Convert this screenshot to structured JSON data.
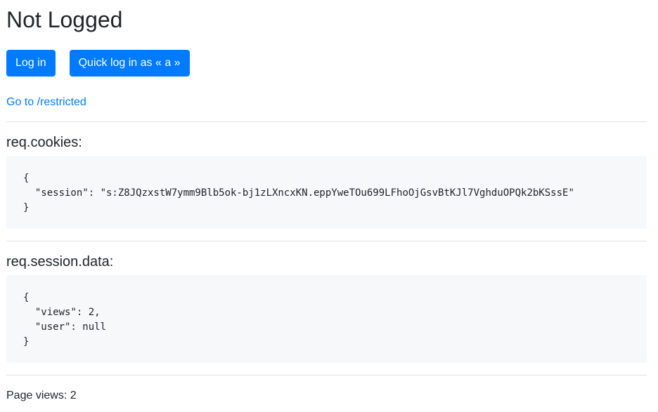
{
  "header": {
    "title": "Not Logged"
  },
  "actions": {
    "login_label": "Log in",
    "quick_login_label": "Quick log in as « a »"
  },
  "nav": {
    "restricted_link": "Go to /restricted"
  },
  "cookies": {
    "title": "req.cookies:",
    "json": "{\n  \"session\": \"s:Z8JQzxstW7ymm9Blb5ok-bj1zLXncxKN.eppYweTOu699LFhoOjGsvBtKJl7VghduOPQk2bKSssE\"\n}"
  },
  "session_data": {
    "title": "req.session.data:",
    "json": "{\n  \"views\": 2,\n  \"user\": null\n}"
  },
  "footer": {
    "page_views": "Page views: 2"
  },
  "colors": {
    "primary": "#007bff",
    "code_bg": "#f7f8f9",
    "divider": "#dee2e6"
  }
}
